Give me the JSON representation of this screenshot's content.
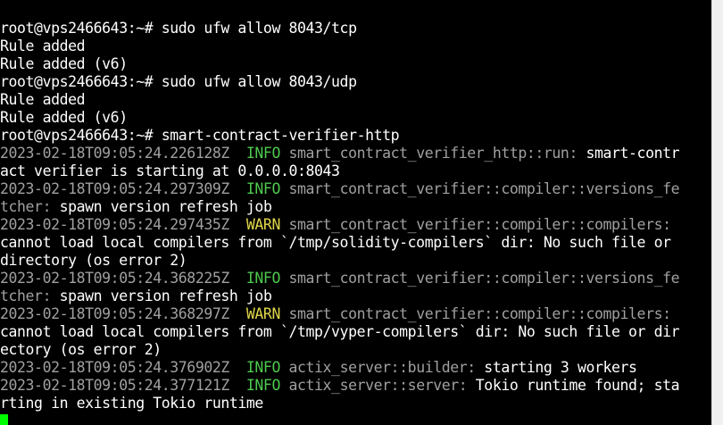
{
  "terminal": {
    "lines": [
      {
        "parts": [
          {
            "t": "txt",
            "v": "root@vps2466643:~# sudo ufw allow 8043/tcp"
          }
        ]
      },
      {
        "parts": [
          {
            "t": "txt",
            "v": "Rule added"
          }
        ]
      },
      {
        "parts": [
          {
            "t": "txt",
            "v": "Rule added (v6)"
          }
        ]
      },
      {
        "parts": [
          {
            "t": "txt",
            "v": "root@vps2466643:~# sudo ufw allow 8043/udp"
          }
        ]
      },
      {
        "parts": [
          {
            "t": "txt",
            "v": "Rule added"
          }
        ]
      },
      {
        "parts": [
          {
            "t": "txt",
            "v": "Rule added (v6)"
          }
        ]
      },
      {
        "parts": [
          {
            "t": "txt",
            "v": "root@vps2466643:~# smart-contract-verifier-http"
          }
        ]
      },
      {
        "parts": [
          {
            "t": "ts",
            "v": "2023-02-18T09:05:24.226128Z  "
          },
          {
            "t": "info",
            "v": "INFO"
          },
          {
            "t": "mod",
            "v": " smart_contract_verifier_http::run:"
          },
          {
            "t": "txt",
            "v": " smart-contr"
          }
        ]
      },
      {
        "parts": [
          {
            "t": "txt",
            "v": "act verifier is starting at 0.0.0.0:8043"
          }
        ]
      },
      {
        "parts": [
          {
            "t": "ts",
            "v": "2023-02-18T09:05:24.297309Z  "
          },
          {
            "t": "info",
            "v": "INFO"
          },
          {
            "t": "mod",
            "v": " smart_contract_verifier::compiler::versions_fe"
          }
        ]
      },
      {
        "parts": [
          {
            "t": "mod",
            "v": "tcher:"
          },
          {
            "t": "txt",
            "v": " spawn version refresh job"
          }
        ]
      },
      {
        "parts": [
          {
            "t": "ts",
            "v": "2023-02-18T09:05:24.297435Z  "
          },
          {
            "t": "warn",
            "v": "WARN"
          },
          {
            "t": "mod",
            "v": " smart_contract_verifier::compiler::compilers:"
          }
        ]
      },
      {
        "parts": [
          {
            "t": "txt",
            "v": "cannot load local compilers from `/tmp/solidity-compilers` dir: No such file or"
          }
        ]
      },
      {
        "parts": [
          {
            "t": "txt",
            "v": "directory (os error 2)"
          }
        ]
      },
      {
        "parts": [
          {
            "t": "ts",
            "v": "2023-02-18T09:05:24.368225Z  "
          },
          {
            "t": "info",
            "v": "INFO"
          },
          {
            "t": "mod",
            "v": " smart_contract_verifier::compiler::versions_fe"
          }
        ]
      },
      {
        "parts": [
          {
            "t": "mod",
            "v": "tcher:"
          },
          {
            "t": "txt",
            "v": " spawn version refresh job"
          }
        ]
      },
      {
        "parts": [
          {
            "t": "ts",
            "v": "2023-02-18T09:05:24.368297Z  "
          },
          {
            "t": "warn",
            "v": "WARN"
          },
          {
            "t": "mod",
            "v": " smart_contract_verifier::compiler::compilers:"
          }
        ]
      },
      {
        "parts": [
          {
            "t": "txt",
            "v": "cannot load local compilers from `/tmp/vyper-compilers` dir: No such file or dir"
          }
        ]
      },
      {
        "parts": [
          {
            "t": "txt",
            "v": "ectory (os error 2)"
          }
        ]
      },
      {
        "parts": [
          {
            "t": "ts",
            "v": "2023-02-18T09:05:24.376902Z  "
          },
          {
            "t": "info",
            "v": "INFO"
          },
          {
            "t": "mod",
            "v": " actix_server::builder:"
          },
          {
            "t": "txt",
            "v": " starting 3 workers"
          }
        ]
      },
      {
        "parts": [
          {
            "t": "ts",
            "v": "2023-02-18T09:05:24.377121Z  "
          },
          {
            "t": "info",
            "v": "INFO"
          },
          {
            "t": "mod",
            "v": " actix_server::server:"
          },
          {
            "t": "txt",
            "v": " Tokio runtime found; sta"
          }
        ]
      },
      {
        "parts": [
          {
            "t": "txt",
            "v": "rting in existing Tokio runtime"
          }
        ]
      }
    ]
  },
  "colors": {
    "background": "#000000",
    "text": "#ffffff",
    "dim": "#a0a0a0",
    "info": "#4ec94e",
    "warn": "#e0d74a",
    "cursor": "#00ff00"
  }
}
